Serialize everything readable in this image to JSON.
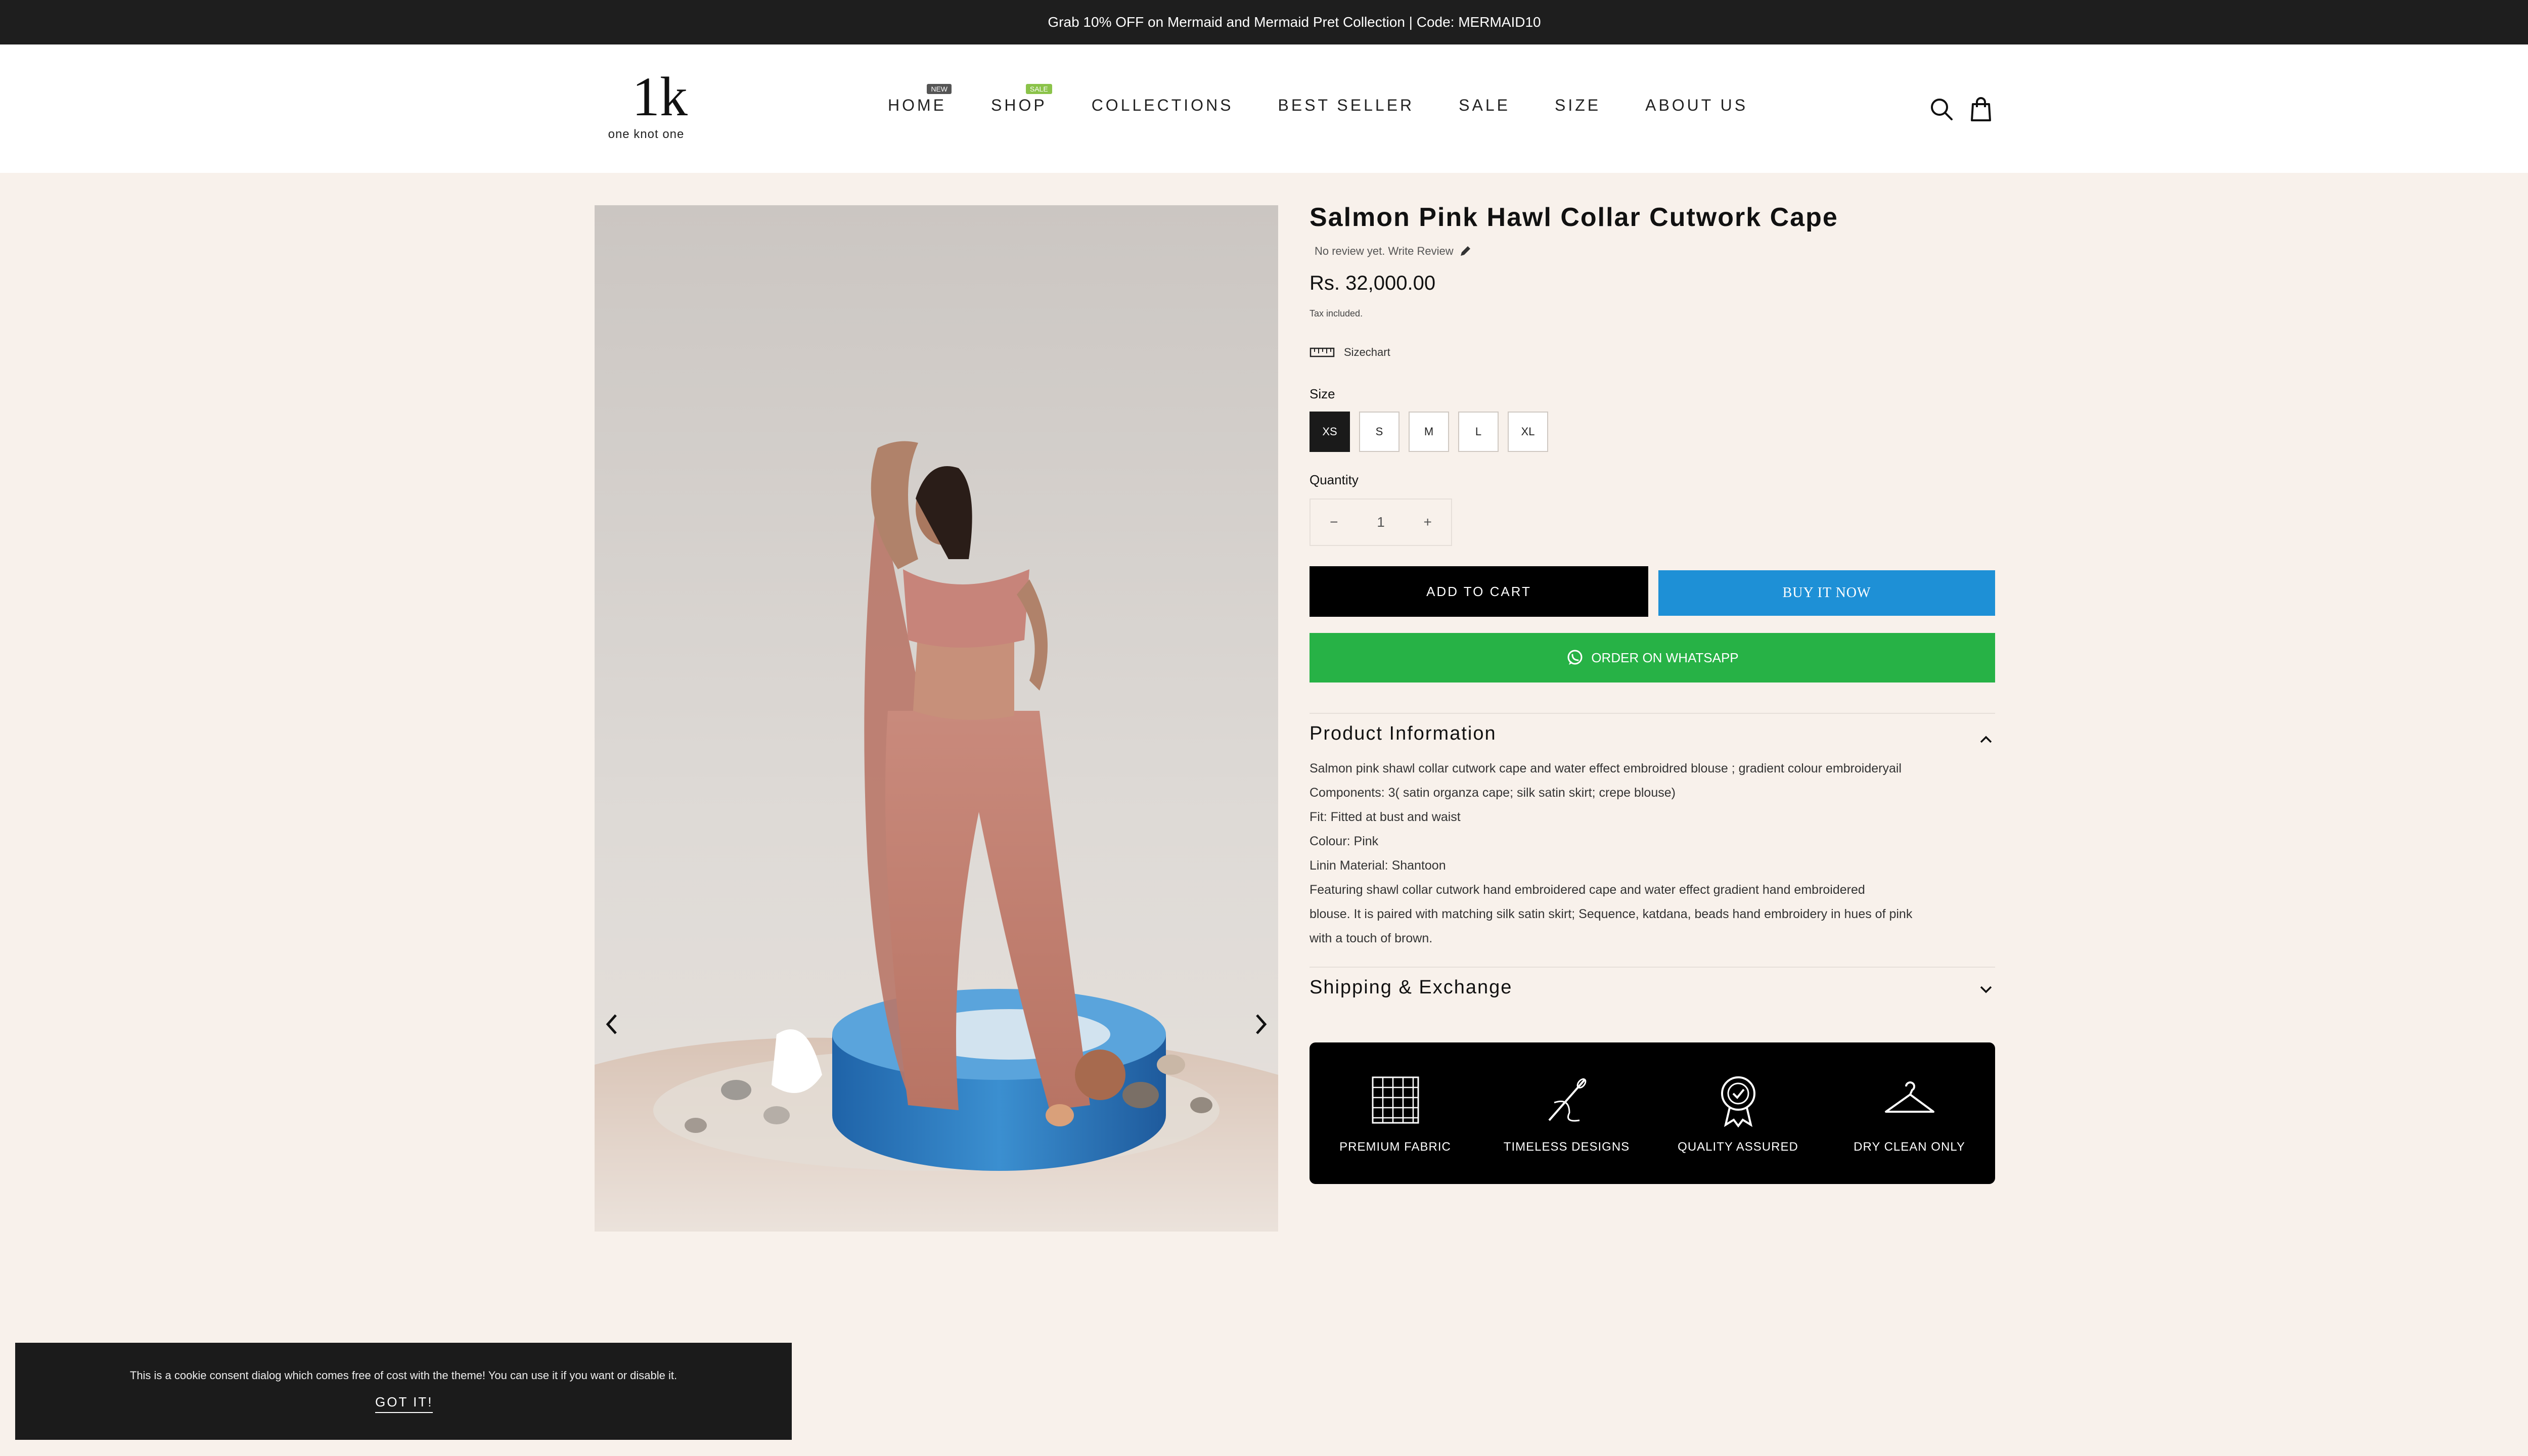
{
  "announcement": "Grab 10% OFF on Mermaid and Mermaid Pret Collection | Code: MERMAID10",
  "brand": {
    "mark": "1k",
    "name": "one knot one"
  },
  "nav": [
    {
      "label": "HOME",
      "badge": "NEW",
      "badge_color": "#555555"
    },
    {
      "label": "SHOP",
      "badge": "SALE",
      "badge_color": "#8bc34a"
    },
    {
      "label": "COLLECTIONS"
    },
    {
      "label": "BEST SELLER"
    },
    {
      "label": "SALE"
    },
    {
      "label": "SIZE"
    },
    {
      "label": "ABOUT US"
    }
  ],
  "header_icons": [
    "search-icon",
    "cart-icon"
  ],
  "product": {
    "title": "Salmon Pink Hawl Collar Cutwork  Cape",
    "review_text": "No review yet. Write Review",
    "price": "Rs. 32,000.00",
    "tax_note": "Tax included.",
    "sizechart_label": "Sizechart",
    "size_label": "Size",
    "sizes": [
      "XS",
      "S",
      "M",
      "L",
      "XL"
    ],
    "selected_size": "XS",
    "quantity_label": "Quantity",
    "quantity": "1",
    "qty_minus": "−",
    "qty_plus": "+",
    "add_to_cart": "ADD TO CART",
    "buy_now": "BUY IT NOW",
    "whatsapp": "ORDER ON WHATSAPP"
  },
  "accordions": {
    "info_title": "Product Information",
    "info_lines": [
      "Salmon pink shawl collar cutwork cape and water effect embroidred blouse ; gradient colour embroideryail",
      "Components: 3( satin organza cape; silk satin skirt; crepe blouse)",
      "Fit: Fitted at bust and waist",
      "Colour: Pink",
      "Linin Material: Shantoon",
      "Featuring shawl collar cutwork hand embroidered cape and water effect gradient hand embroidered",
      "blouse. It is paired with matching silk satin skirt; Sequence, katdana, beads hand embroidery in hues of pink",
      "with a touch of brown."
    ],
    "shipping_title": "Shipping & Exchange"
  },
  "features": [
    {
      "label": "PREMIUM FABRIC",
      "icon": "fabric-icon"
    },
    {
      "label": "TIMELESS DESIGNS",
      "icon": "needle-icon"
    },
    {
      "label": "QUALITY ASSURED",
      "icon": "quality-badge-icon"
    },
    {
      "label": "DRY CLEAN ONLY",
      "icon": "hanger-icon"
    }
  ],
  "cookie": {
    "text": "This is a cookie consent dialog which comes free of cost with the theme! You can use it if you want or disable it.",
    "button": "GOT IT!"
  },
  "colors": {
    "announcement_bg": "#1e1e1e",
    "page_bg": "#f8f1eb",
    "buy_now": "#1e90d6",
    "whatsapp": "#27b246"
  }
}
